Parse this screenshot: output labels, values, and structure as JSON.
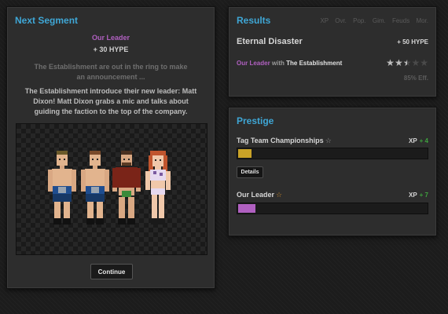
{
  "next_segment": {
    "title": "Next Segment",
    "leader": "Our Leader",
    "hype": "+ 30 HYPE",
    "description_faded": "The Establishment are out in the ring to make an announcement ...",
    "description": "The Establishment introduce their new leader: Matt Dixon! Matt Dixon grabs a mic and talks about guiding the faction to the top of the company.",
    "continue_label": "Continue"
  },
  "results": {
    "title": "Results",
    "headers": [
      "XP",
      "Ovr.",
      "Pop.",
      "Gim.",
      "Feuds",
      "Mor."
    ],
    "segment_name": "Eternal Disaster",
    "hype": "+ 50 HYPE",
    "participant_1": "Our Leader",
    "with_text": " with ",
    "participant_2": "The Establishment",
    "rating_stars": 2.5,
    "rating_max": 5,
    "efficiency": "85% Eff."
  },
  "prestige": {
    "title": "Prestige",
    "items": [
      {
        "label": "Tag Team Championships",
        "star_color": "#9a9a9a",
        "xp_label": "XP",
        "xp_delta": "+ 4",
        "progress": 0.07,
        "bar_color": "#c9a227"
      },
      {
        "label": "Our Leader",
        "star_color": "#d08a2a",
        "xp_label": "XP",
        "xp_delta": "+ 7",
        "progress": 0.09,
        "bar_color": "#b060c0"
      }
    ],
    "details_label": "Details"
  }
}
